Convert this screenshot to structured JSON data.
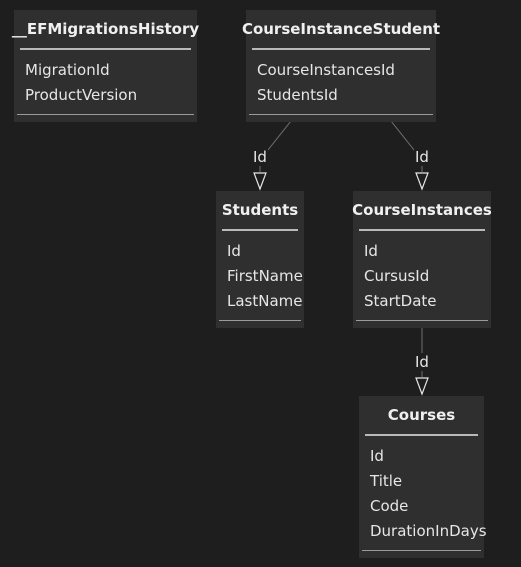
{
  "entities": {
    "ef_migrations_history": {
      "name": "__EFMigrationsHistory",
      "attributes": [
        "MigrationId",
        "ProductVersion"
      ]
    },
    "course_instance_student": {
      "name": "CourseInstanceStudent",
      "attributes": [
        "CourseInstancesId",
        "StudentsId"
      ]
    },
    "students": {
      "name": "Students",
      "attributes": [
        "Id",
        "FirstName",
        "LastName"
      ]
    },
    "course_instances": {
      "name": "CourseInstances",
      "attributes": [
        "Id",
        "CursusId",
        "StartDate"
      ]
    },
    "courses": {
      "name": "Courses",
      "attributes": [
        "Id",
        "Title",
        "Code",
        "DurationInDays"
      ]
    }
  },
  "relationships": [
    {
      "from": "CourseInstanceStudent",
      "to": "Students",
      "label": "Id"
    },
    {
      "from": "CourseInstanceStudent",
      "to": "CourseInstances",
      "label": "Id"
    },
    {
      "from": "CourseInstances",
      "to": "Courses",
      "label": "Id"
    }
  ],
  "colors": {
    "background": "#1e1e1e",
    "entity_fill": "#2f2f2f",
    "divider": "#b9b9b9",
    "text": "#e6e6e6",
    "edge": "#6f6f6f"
  }
}
